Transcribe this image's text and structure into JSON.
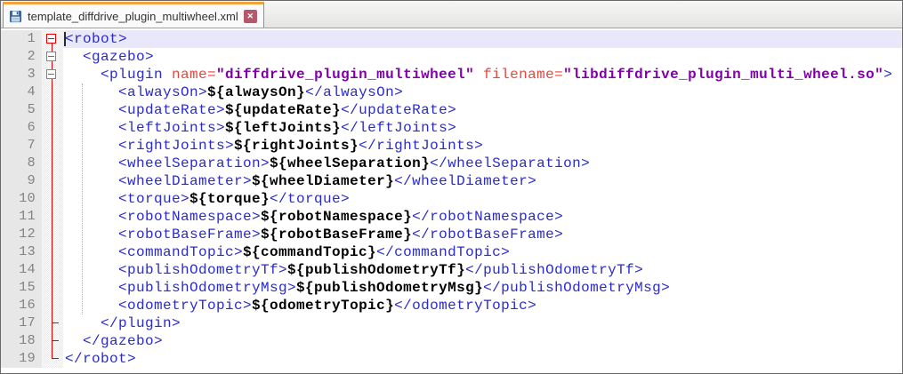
{
  "tab_bar": {
    "tabs": [
      {
        "title": "template_diffdrive_plugin_multiwheel.xml",
        "active": true,
        "icon": "floppy-disk-icon",
        "close_glyph": "✕"
      }
    ]
  },
  "editor": {
    "language": "XML",
    "current_line": 1,
    "caret": {
      "line": 1,
      "col": 0
    },
    "colors": {
      "tag": "#2B2BC8",
      "attr": "#E8473C",
      "val": "#8000A8",
      "var": "#000000",
      "fold": "#E60000",
      "fold_inactive": "#848484",
      "curline": "#E8E8FA",
      "linenum": "#828282",
      "gutter_bg": "#E7E7E7",
      "guide": "#ABABAB",
      "tab_accent": "#F2A33C",
      "close_btn": "#B4596B"
    },
    "lines": [
      {
        "n": 1,
        "fold": "box-active",
        "current": true,
        "caret": true,
        "segs": [
          [
            "<robot>",
            "tag"
          ]
        ]
      },
      {
        "n": 2,
        "fold": "box",
        "segs": [
          [
            "  <gazebo>",
            "tag"
          ]
        ]
      },
      {
        "n": 3,
        "fold": "box",
        "segs": [
          [
            "    <plugin ",
            "tag"
          ],
          [
            "name=",
            "attr"
          ],
          [
            "\"diffdrive_plugin_multiwheel\"",
            "val"
          ],
          [
            " ",
            "plain"
          ],
          [
            "filename=",
            "attr"
          ],
          [
            "\"libdiffdrive_plugin_multi_wheel.so\"",
            "val"
          ],
          [
            ">",
            "tag"
          ]
        ]
      },
      {
        "n": 4,
        "fold": "line",
        "segs": [
          [
            "      <alwaysOn>",
            "tag"
          ],
          [
            "${alwaysOn}",
            "var"
          ],
          [
            "</alwaysOn>",
            "tag"
          ]
        ]
      },
      {
        "n": 5,
        "fold": "line",
        "segs": [
          [
            "      <updateRate>",
            "tag"
          ],
          [
            "${updateRate}",
            "var"
          ],
          [
            "</updateRate>",
            "tag"
          ]
        ]
      },
      {
        "n": 6,
        "fold": "line",
        "segs": [
          [
            "      <leftJoints>",
            "tag"
          ],
          [
            "${leftJoints}",
            "var"
          ],
          [
            "</leftJoints>",
            "tag"
          ]
        ]
      },
      {
        "n": 7,
        "fold": "line",
        "segs": [
          [
            "      <rightJoints>",
            "tag"
          ],
          [
            "${rightJoints}",
            "var"
          ],
          [
            "</rightJoints>",
            "tag"
          ]
        ]
      },
      {
        "n": 8,
        "fold": "line",
        "segs": [
          [
            "      <wheelSeparation>",
            "tag"
          ],
          [
            "${wheelSeparation}",
            "var"
          ],
          [
            "</wheelSeparation>",
            "tag"
          ]
        ]
      },
      {
        "n": 9,
        "fold": "line",
        "segs": [
          [
            "      <wheelDiameter>",
            "tag"
          ],
          [
            "${wheelDiameter}",
            "var"
          ],
          [
            "</wheelDiameter>",
            "tag"
          ]
        ]
      },
      {
        "n": 10,
        "fold": "line",
        "segs": [
          [
            "      <torque>",
            "tag"
          ],
          [
            "${torque}",
            "var"
          ],
          [
            "</torque>",
            "tag"
          ]
        ]
      },
      {
        "n": 11,
        "fold": "line",
        "segs": [
          [
            "      <robotNamespace>",
            "tag"
          ],
          [
            "${robotNamespace}",
            "var"
          ],
          [
            "</robotNamespace>",
            "tag"
          ]
        ]
      },
      {
        "n": 12,
        "fold": "line",
        "segs": [
          [
            "      <robotBaseFrame>",
            "tag"
          ],
          [
            "${robotBaseFrame}",
            "var"
          ],
          [
            "</robotBaseFrame>",
            "tag"
          ]
        ]
      },
      {
        "n": 13,
        "fold": "line",
        "segs": [
          [
            "      <commandTopic>",
            "tag"
          ],
          [
            "${commandTopic}",
            "var"
          ],
          [
            "</commandTopic>",
            "tag"
          ]
        ]
      },
      {
        "n": 14,
        "fold": "line",
        "segs": [
          [
            "      <publishOdometryTf>",
            "tag"
          ],
          [
            "${publishOdometryTf}",
            "var"
          ],
          [
            "</publishOdometryTf>",
            "tag"
          ]
        ]
      },
      {
        "n": 15,
        "fold": "line",
        "segs": [
          [
            "      <publishOdometryMsg>",
            "tag"
          ],
          [
            "${publishOdometryMsg}",
            "var"
          ],
          [
            "</publishOdometryMsg>",
            "tag"
          ]
        ]
      },
      {
        "n": 16,
        "fold": "line",
        "segs": [
          [
            "      <odometryTopic>",
            "tag"
          ],
          [
            "${odometryTopic}",
            "var"
          ],
          [
            "</odometryTopic>",
            "tag"
          ]
        ]
      },
      {
        "n": 17,
        "fold": "tail",
        "segs": [
          [
            "    </plugin>",
            "tag"
          ]
        ]
      },
      {
        "n": 18,
        "fold": "tail",
        "segs": [
          [
            "  </gazebo>",
            "tag"
          ]
        ]
      },
      {
        "n": 19,
        "fold": "end",
        "segs": [
          [
            "</robot>",
            "tag"
          ]
        ]
      }
    ]
  }
}
